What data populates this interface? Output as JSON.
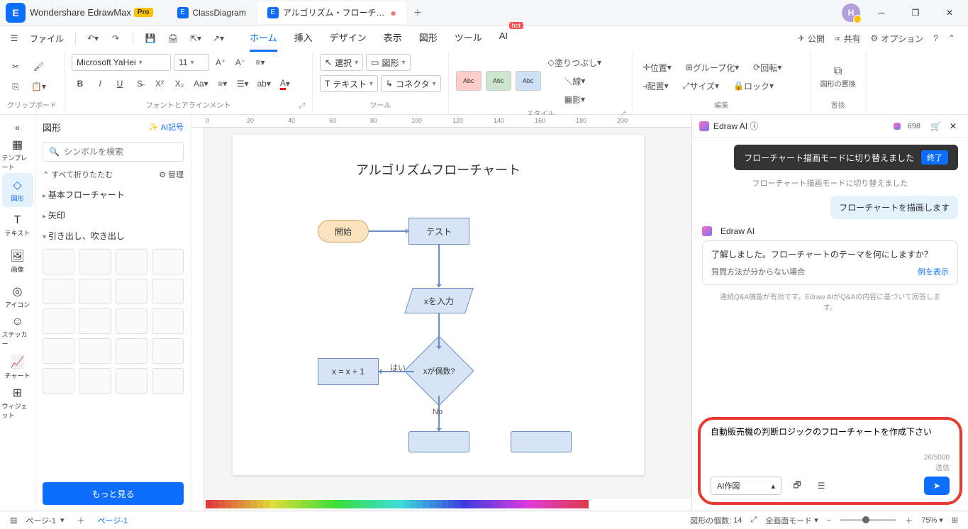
{
  "app": {
    "name": "Wondershare EdrawMax",
    "badge": "Pro"
  },
  "tabs": [
    {
      "label": "ClassDiagram"
    },
    {
      "label": "アルゴリズム・フローチ…",
      "active": true,
      "modified": true
    }
  ],
  "avatar_initial": "H",
  "menubar": {
    "file": "ファイル"
  },
  "menu_tabs": {
    "home": "ホーム",
    "insert": "挿入",
    "design": "デザイン",
    "view": "表示",
    "shape": "図形",
    "tool": "ツール",
    "ai": "AI",
    "hot": "hot"
  },
  "menubar_right": {
    "publish": "公開",
    "share": "共有",
    "options": "オプション"
  },
  "ribbon": {
    "clipboard": "クリップボード",
    "font_align": "フォントとアラインメント",
    "font_name": "Microsoft YaHei",
    "font_size": "11",
    "tool": "ツール",
    "select": "選択",
    "shape": "図形",
    "text": "テキスト",
    "connector": "コネクタ",
    "style": "スタイル",
    "style_label": "Abc",
    "fill": "塗りつぶし",
    "line": "線",
    "shadow": "影",
    "edit": "編集",
    "position": "位置",
    "align": "配置",
    "group": "グループ化",
    "size": "サイズ",
    "rotate": "回転",
    "lock": "ロック",
    "replace": "置換",
    "replace_shape": "図形の置換"
  },
  "leftrail": {
    "template": "テンプレート",
    "shape": "図形",
    "text": "テキスト",
    "image": "画像",
    "icon": "アイコン",
    "sticker": "ステッカー",
    "chart": "チャート",
    "widget": "ウィジェット"
  },
  "shapes_panel": {
    "title": "図形",
    "ai_symbol": "AI記号",
    "search_placeholder": "シンボルを検索",
    "collapse_all": "すべて折りたたむ",
    "manage": "管理",
    "cat_basic": "基本フローチャート",
    "cat_arrow": "矢印",
    "cat_callout": "引き出し、吹き出し",
    "more": "もっと見る"
  },
  "canvas": {
    "title": "アルゴリズムフローチャート",
    "start": "開始",
    "test": "テスト",
    "input": "xを入力",
    "decision": "xが偶数?",
    "calc": "x = x + 1",
    "yes_label": "はい",
    "no_label": "No"
  },
  "ruler_marks": [
    "0",
    "20",
    "40",
    "60",
    "80",
    "100",
    "120",
    "140",
    "160",
    "180",
    "200"
  ],
  "ai": {
    "title": "Edraw AI",
    "credits": "698",
    "toast_msg": "フローチャート描画モードに切り替えました",
    "toast_btn": "終了",
    "sys_msg": "フローチャート描画モードに切り替えました",
    "user_msg": "フローチャートを描画します",
    "bot_name": "Edraw AI",
    "card_title": "了解しました。フローチャートのテーマを何にしますか？",
    "card_hint": "質問方法が分からない場合",
    "card_link": "例を表示",
    "note": "連続Q&A機能が有効です。Edraw AIがQ&Aの内容に基づいて回答します。",
    "input_text": "自動販売機の判断ロジックのフローチャートを作成下さい",
    "counter_cur": "26",
    "counter_max": "/5000",
    "send_label": "送信",
    "mode": "AI作図"
  },
  "statusbar": {
    "page_select": "ページ-1",
    "page_tab": "ページ-1",
    "shape_count_label": "図形の個数:",
    "shape_count": "14",
    "fullscreen": "全画面モード",
    "zoom": "75%"
  }
}
